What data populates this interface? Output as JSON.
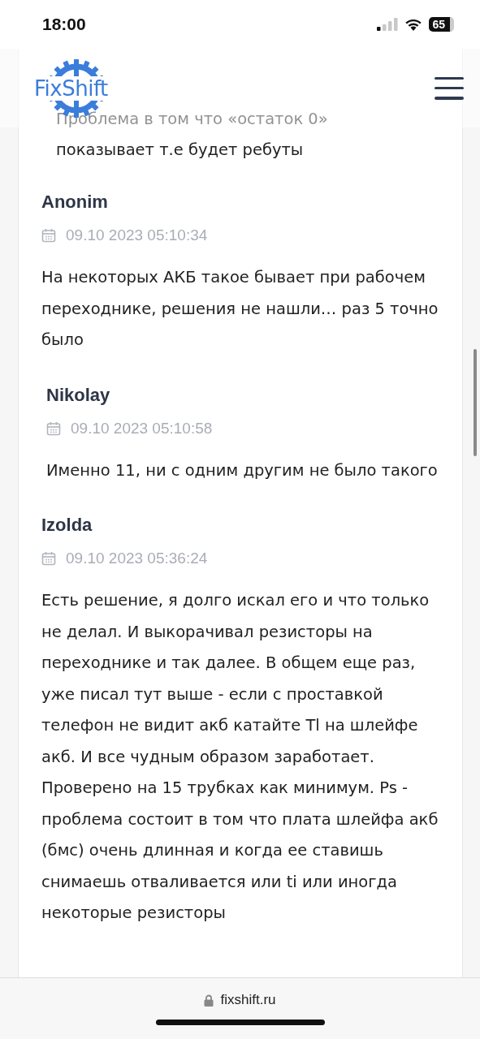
{
  "status_bar": {
    "time": "18:00",
    "battery": "65"
  },
  "header": {
    "logo": "FixShift"
  },
  "previous_comment_text": "Проблема в том что «остаток 0» показывает т.е будет ребуты",
  "comments": [
    {
      "author": "Anonim",
      "date": "09.10 2023 05:10:34",
      "text": "На некоторых АКБ такое бывает при рабочем переходнике, решения не нашли… раз 5 точно было",
      "children": [
        {
          "author": "Nikolay",
          "date": "09.10 2023 05:10:58",
          "text": "Именно 11, ни с одним другим не было такого"
        }
      ]
    },
    {
      "author": "Izolda",
      "date": "09.10 2023 05:36:24",
      "text": "Есть решение, я долго искал его и что только не делал. И выкорачивал резисторы на переходнике и так далее. В общем еще раз, уже писал тут выше - если с проставкой телефон не видит акб катайте Tl на шлейфе акб. И все чудным образом заработает. Проверено на 15 трубках как минимум. Ps - проблема состоит в том что плата шлейфа акб (бмс) очень длинная и когда ее ставишь снимаешь отваливается или ti или иногда некоторые резисторы"
    }
  ],
  "browser_bar": {
    "url": "fixshift.ru"
  }
}
